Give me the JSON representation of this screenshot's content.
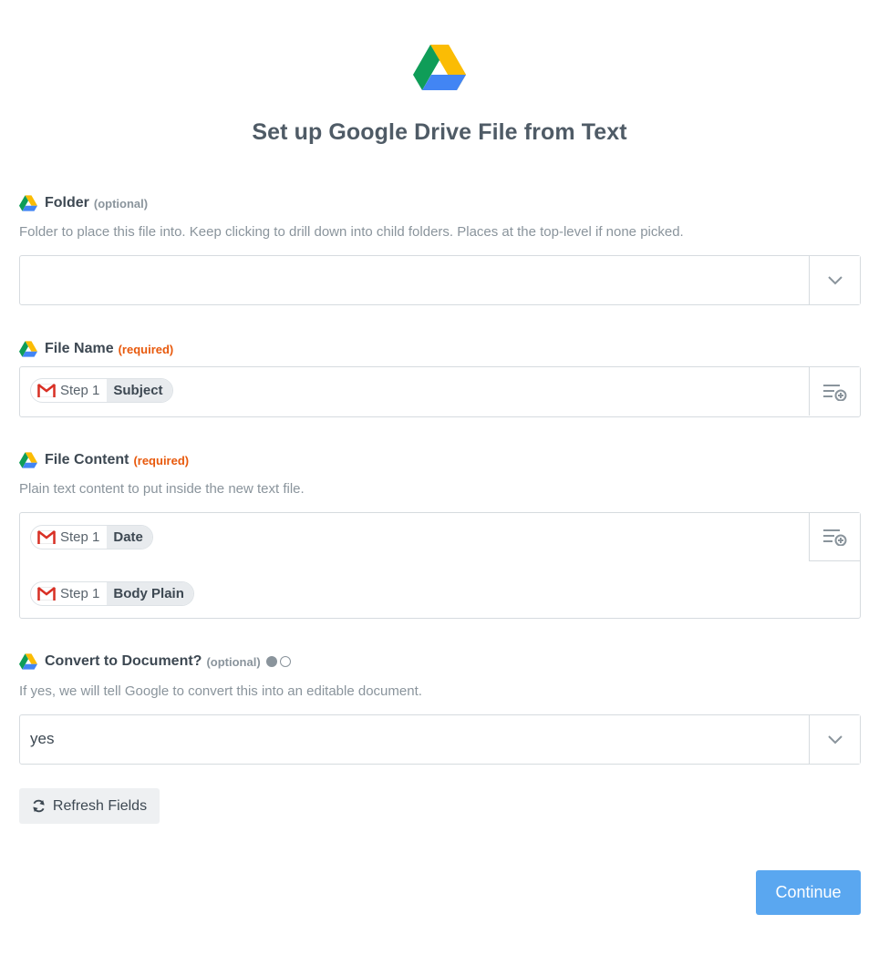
{
  "header": {
    "title": "Set up Google Drive File from Text",
    "logo_icon": "google-drive-icon"
  },
  "fields": {
    "folder": {
      "label": "Folder",
      "badge": "(optional)",
      "help": "Folder to place this file into. Keep clicking to drill down into child folders. Places at the top-level if none picked.",
      "value": ""
    },
    "file_name": {
      "label": "File Name",
      "badge": "(required)",
      "tokens": [
        {
          "step": "Step 1",
          "field": "Subject",
          "icon": "gmail-icon"
        }
      ]
    },
    "file_content": {
      "label": "File Content",
      "badge": "(required)",
      "help": "Plain text content to put inside the new text file.",
      "tokens": [
        {
          "step": "Step 1",
          "field": "Date",
          "icon": "gmail-icon"
        },
        {
          "step": "Step 1",
          "field": "Body Plain",
          "icon": "gmail-icon"
        }
      ]
    },
    "convert": {
      "label": "Convert to Document?",
      "badge": "(optional)",
      "help": "If yes, we will tell Google to convert this into an editable document.",
      "value": "yes"
    }
  },
  "actions": {
    "refresh_label": "Refresh Fields",
    "continue_label": "Continue"
  },
  "colors": {
    "accent": "#5aa7f0",
    "required": "#e8590c",
    "muted": "#8a949c"
  }
}
